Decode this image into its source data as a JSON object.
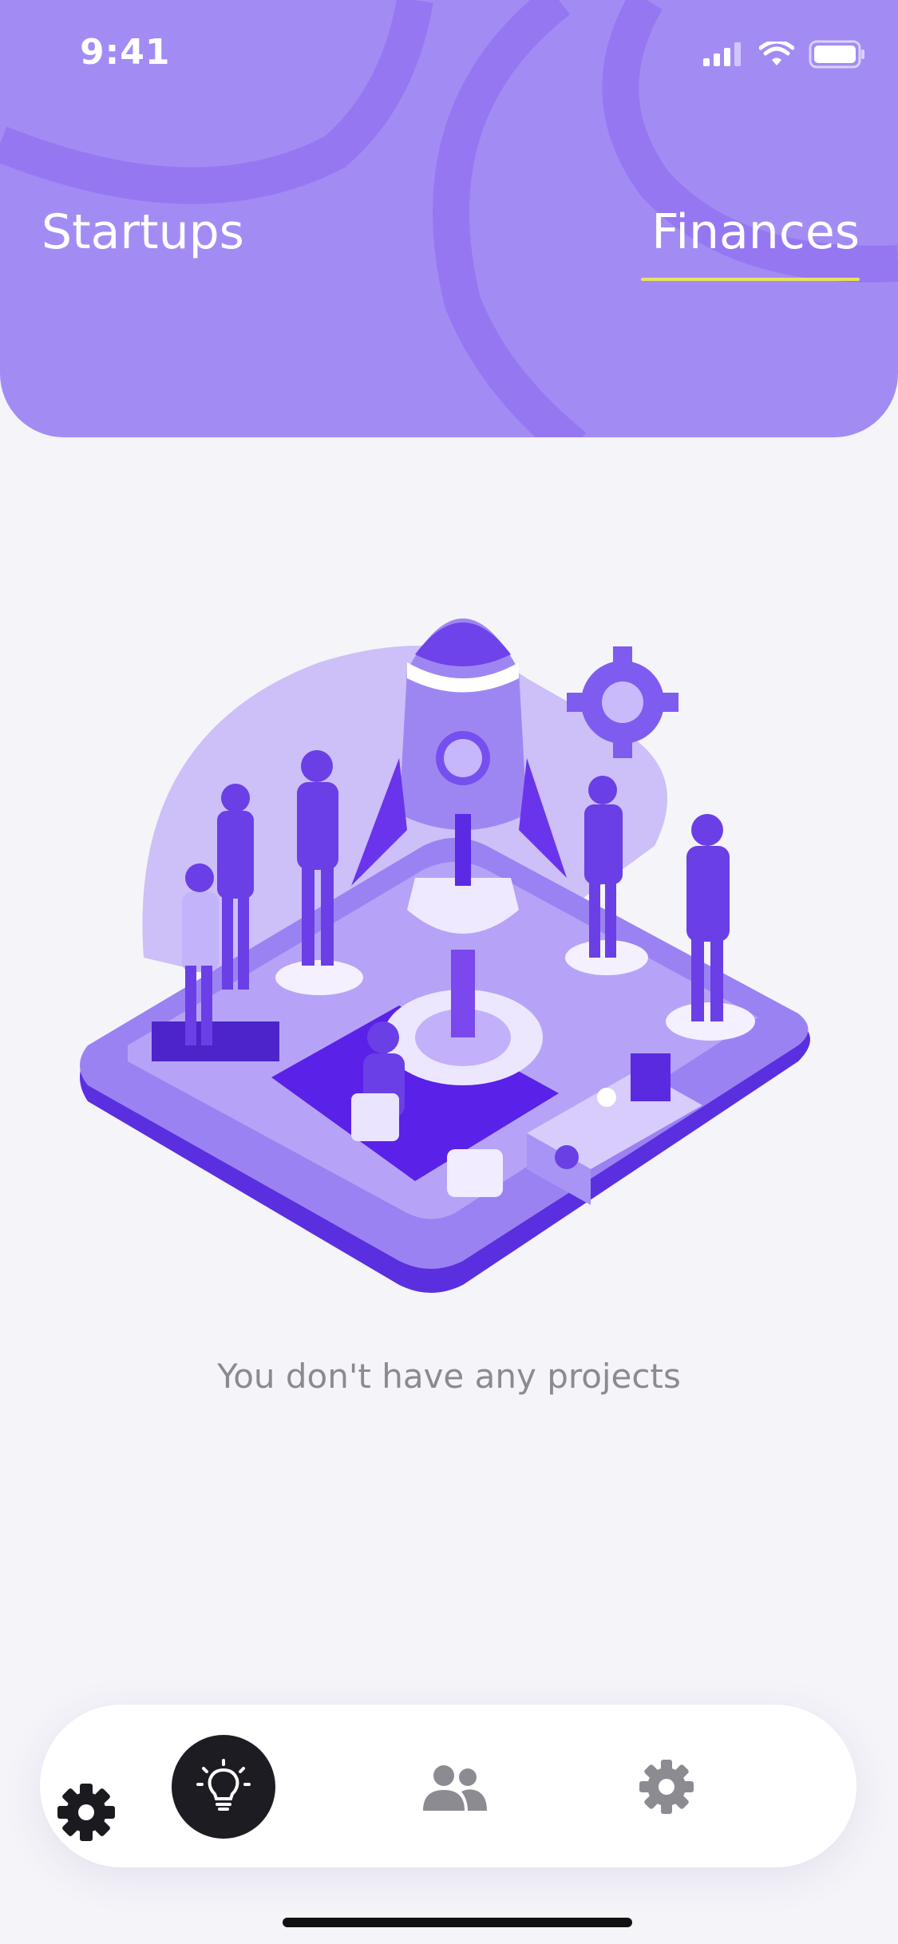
{
  "status_bar": {
    "time": "9:41"
  },
  "header": {
    "tabs": [
      {
        "label": "Startups",
        "active": false
      },
      {
        "label": "Finances",
        "active": true
      }
    ],
    "accent_color": "#a28cf4",
    "underline_color": "#e8e25c"
  },
  "empty_state": {
    "message": "You don't have any projects",
    "illustration": "rocket-launch-team-illustration"
  },
  "bottom_nav": {
    "items": [
      {
        "icon": "lightbulb-icon",
        "active": true
      },
      {
        "icon": "team-icon",
        "active": false
      },
      {
        "icon": "gear-icon",
        "active": false
      }
    ],
    "floating_icon": "gear-icon"
  }
}
